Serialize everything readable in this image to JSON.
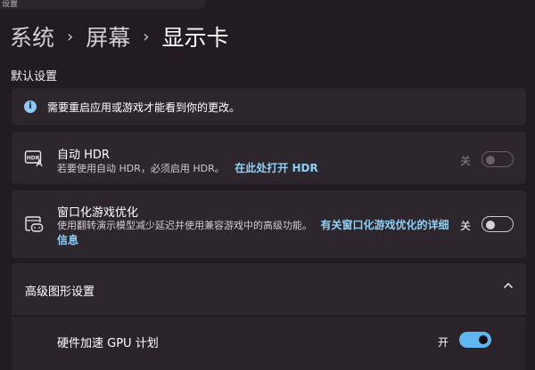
{
  "window": {
    "title_fragment": "设置"
  },
  "breadcrumb": {
    "items": [
      "系统",
      "屏幕",
      "显示卡"
    ]
  },
  "section": {
    "title": "默认设置"
  },
  "info": {
    "text": "需要重启应用或游戏才能看到你的更改。"
  },
  "auto_hdr": {
    "title": "自动 HDR",
    "desc": "若要使用自动 HDR，必须启用 HDR。",
    "link": "在此处打开 HDR",
    "state_label": "关",
    "value": false
  },
  "windowed": {
    "title": "窗口化游戏优化",
    "desc": "使用翻转演示模型减少延迟并使用兼容游戏中的高级功能。",
    "link": "有关窗口化游戏优化的详细信息",
    "state_label": "关",
    "value": false
  },
  "advanced": {
    "title": "高级图形设置",
    "chevron": "chevron-up-icon"
  },
  "gpu_scheduling": {
    "title": "硬件加速 GPU 计划",
    "state_label": "开",
    "value": true
  },
  "colors": {
    "accent": "#5fb7ef",
    "link": "#8fd0f4",
    "card": "#2d262d",
    "background": "#221c22"
  }
}
